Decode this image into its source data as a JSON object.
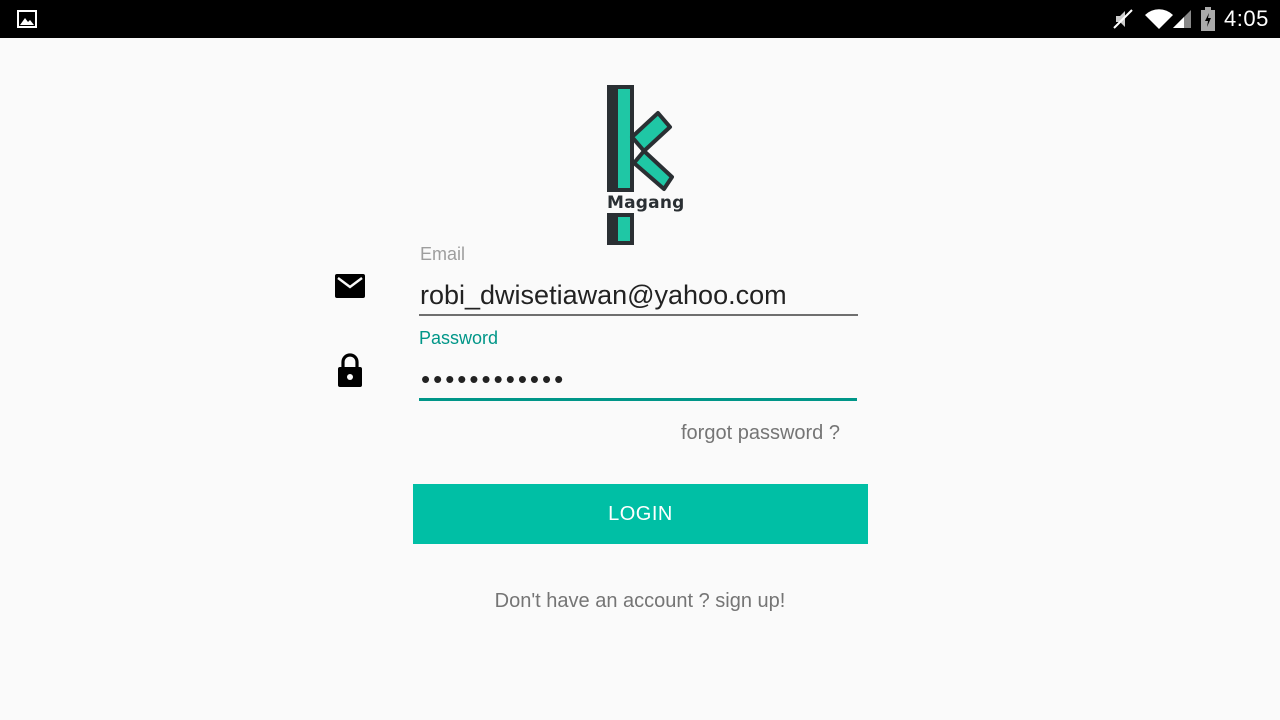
{
  "status_bar": {
    "time": "4:05",
    "icons": [
      "gallery-icon",
      "mute-icon",
      "wifi-icon",
      "signal-icon",
      "battery-icon"
    ]
  },
  "logo": {
    "text": "Magang"
  },
  "email": {
    "label": "Email",
    "value": "robi_dwisetiawan@yahoo.com"
  },
  "password": {
    "label": "Password",
    "value": "••••••••••••"
  },
  "forgot_password": "forgot password ?",
  "login_button": "LOGIN",
  "signup_link": "Don't have an account ? sign up!",
  "colors": {
    "accent": "#00bfa5",
    "focus": "#009688",
    "logo_teal": "#1fc7a5",
    "logo_outline": "#2a2f33"
  }
}
